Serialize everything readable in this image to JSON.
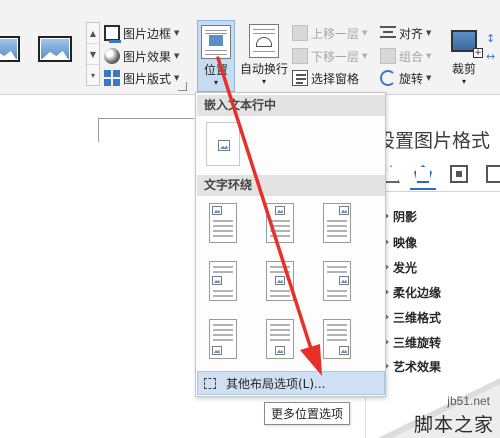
{
  "ribbon": {
    "picture_border": "图片边框",
    "picture_effect": "图片效果",
    "picture_layout": "图片版式",
    "position": "位置",
    "wrap_text": "自动换行",
    "bring_forward": "上移一层",
    "send_backward": "下移一层",
    "selection_pane": "选择窗格",
    "align": "对齐",
    "group": "组合",
    "rotate": "旋转",
    "crop": "裁剪"
  },
  "dropdown": {
    "section_inline": "嵌入文本行中",
    "section_wrap": "文字环绕",
    "more_options": "其他布局选项(L)..."
  },
  "tooltip": "更多位置选项",
  "format_pane": {
    "title": "设置图片格式",
    "items": [
      "阴影",
      "映像",
      "发光",
      "柔化边缘",
      "三维格式",
      "三维旋转",
      "艺术效果"
    ]
  },
  "watermark": {
    "site": "jb51.net",
    "name": "脚本之家"
  },
  "colors": {
    "accent": "#2b6cb8",
    "highlight": "#cfe0f3",
    "arrow": "#e8302a"
  }
}
